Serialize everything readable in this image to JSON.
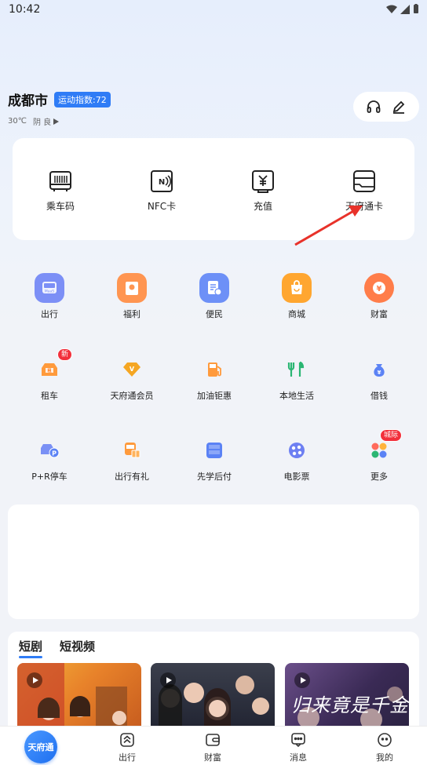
{
  "status": {
    "time": "10:42"
  },
  "location": {
    "city": "成都市",
    "sport_index": "运动指数:72",
    "temperature": "30℃",
    "air_quality": "阴 良"
  },
  "tool_pill": {
    "left_icon": "headphones-icon",
    "right_icon": "edit-icon"
  },
  "quick_cards": [
    {
      "label": "乘车码",
      "icon": "bus-code-icon"
    },
    {
      "label": "NFC卡",
      "icon": "nfc-card-icon"
    },
    {
      "label": "充值",
      "icon": "recharge-icon"
    },
    {
      "label": "天府通卡",
      "icon": "tianfu-card-icon"
    }
  ],
  "grid": {
    "row1": [
      {
        "label": "出行",
        "icon": "maas-icon",
        "color": "#7c8ff6"
      },
      {
        "label": "福利",
        "icon": "gift-icon",
        "color": "#ff9551"
      },
      {
        "label": "便民",
        "icon": "service-icon",
        "color": "#6d90f7"
      },
      {
        "label": "商城",
        "icon": "shop-bag-icon",
        "color": "#ffa630"
      },
      {
        "label": "财富",
        "icon": "yuan-coin-icon",
        "color": "#ff7d4a"
      }
    ],
    "row2": [
      {
        "label": "租车",
        "icon": "rent-car-icon",
        "badge": "新"
      },
      {
        "label": "天府通会员",
        "icon": "vip-icon"
      },
      {
        "label": "加油钜惠",
        "icon": "fuel-icon"
      },
      {
        "label": "本地生活",
        "icon": "local-life-icon"
      },
      {
        "label": "借钱",
        "icon": "money-bag-icon"
      }
    ],
    "row3": [
      {
        "label": "P+R停车",
        "icon": "park-ride-icon"
      },
      {
        "label": "出行有礼",
        "icon": "travel-gift-icon"
      },
      {
        "label": "先学后付",
        "icon": "learn-pay-icon"
      },
      {
        "label": "电影票",
        "icon": "film-icon"
      },
      {
        "label": "更多",
        "icon": "more-icon",
        "badge": "城际"
      }
    ]
  },
  "video_section": {
    "tabs": [
      "短剧",
      "短视频"
    ],
    "thumbs": [
      {
        "name": "drama-1"
      },
      {
        "name": "drama-2"
      },
      {
        "name": "drama-3",
        "title": "归来竟是千金"
      }
    ]
  },
  "bottom_nav": {
    "home": "天府通",
    "items": [
      "出行",
      "财富",
      "消息",
      "我的"
    ]
  },
  "colors": {
    "accent": "#2f7cf6",
    "annotation": "#e8322a"
  }
}
